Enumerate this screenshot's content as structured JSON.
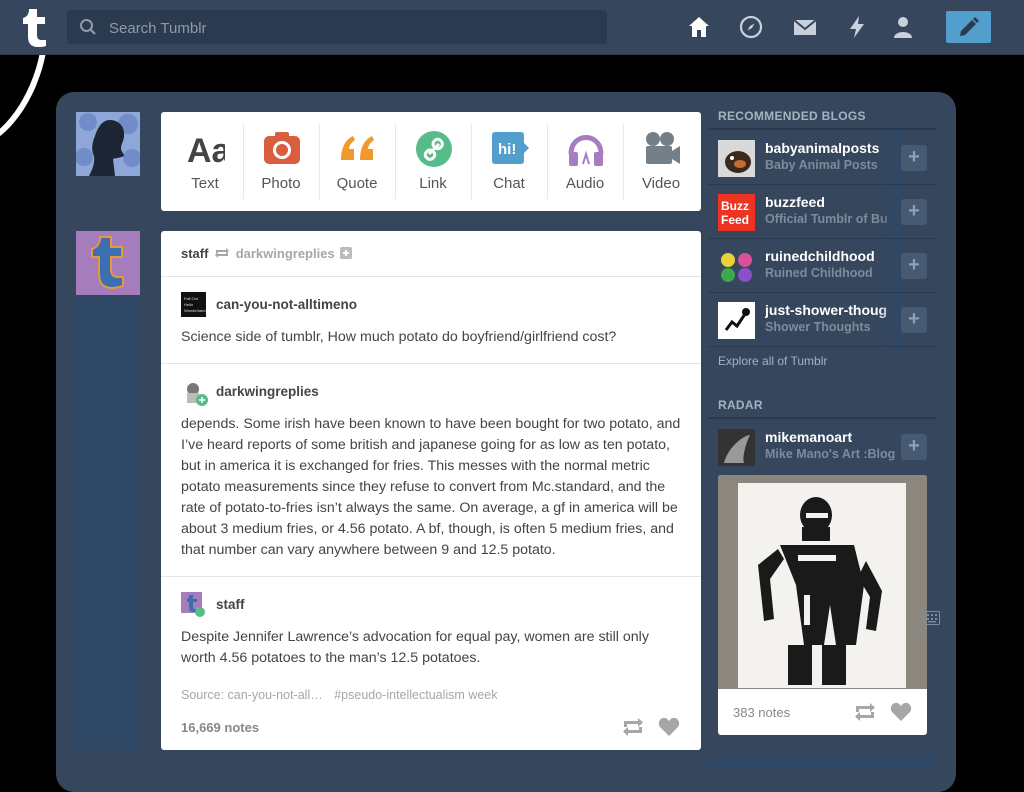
{
  "search": {
    "placeholder": "Search Tumblr"
  },
  "post_types": [
    {
      "label": "Text",
      "color": "#444444"
    },
    {
      "label": "Photo",
      "color": "#d95e40"
    },
    {
      "label": "Quote",
      "color": "#f2992e"
    },
    {
      "label": "Link",
      "color": "#56bc8a"
    },
    {
      "label": "Chat",
      "color": "#529ecc"
    },
    {
      "label": "Audio",
      "color": "#a77dc2"
    },
    {
      "label": "Video",
      "color": "#748089"
    }
  ],
  "post": {
    "header_user": "staff",
    "header_reblogged_from": "darkwingreplies",
    "blocks": [
      {
        "user": "can-you-not-alltimeno",
        "text": "Science side of tumblr, How much potato do boyfriend/girlfriend cost?"
      },
      {
        "user": "darkwingreplies",
        "text": "depends. Some irish have been known to have been bought for two potato, and I’ve heard reports of some british and japanese going for as low as ten potato, but in america it is exchanged for fries. This messes with the normal metric potato measurements since they refuse to convert from Mc.standard, and the rate of potato-to-fries isn’t always the same. On average, a gf in america will be about 3 medium fries, or 4.56 potato. A bf, though, is often 5 medium fries, and that number can vary anywhere between 9 and 12.5 potato."
      },
      {
        "user": "staff",
        "text": "Despite Jennifer Lawrence’s advocation for equal pay, women are still only worth 4.56 potatoes to the man’s 12.5 potatoes."
      }
    ],
    "source": "Source: can-you-not-all…",
    "tags": "#pseudo-intellectualism week",
    "notes": "16,669 notes"
  },
  "sidebar": {
    "recommended_title": "RECOMMENDED BLOGS",
    "blogs": [
      {
        "name": "babyanimalposts",
        "title": "Baby Animal Posts"
      },
      {
        "name": "buzzfeed",
        "title": "Official Tumblr of Bu"
      },
      {
        "name": "ruinedchildhood",
        "title": "Ruined Childhood"
      },
      {
        "name": "just-shower-thoug",
        "title": "Shower Thoughts"
      }
    ],
    "explore": "Explore all of Tumblr",
    "radar_title": "RADAR",
    "radar": {
      "name": "mikemanoart",
      "title": "Mike Mano's Art :Blog",
      "notes": "383 notes"
    }
  },
  "colors": {
    "nav": "#36465d",
    "accent": "#529ecc",
    "background": "#000000"
  },
  "icons": [
    "tumblr-logo-icon",
    "search-icon",
    "home-icon",
    "explore-compass-icon",
    "messages-envelope-icon",
    "activity-lightning-icon",
    "account-person-icon",
    "compose-pencil-icon",
    "reblog-icon",
    "like-heart-icon",
    "follow-plus-icon",
    "keyboard-icon"
  ]
}
